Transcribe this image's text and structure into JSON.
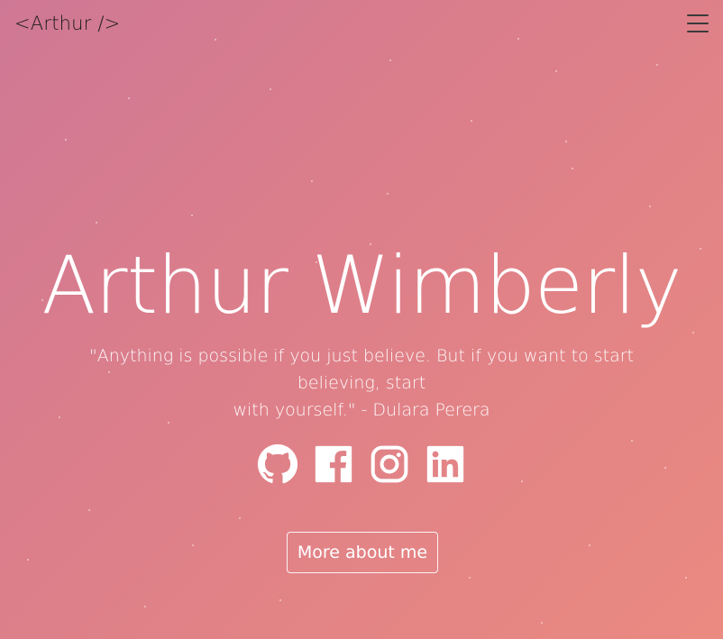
{
  "nav": {
    "brand": "<Arthur />",
    "menu_icon": "hamburger-menu-icon"
  },
  "hero": {
    "name": "Arthur Wimberly",
    "quote_line1": "\"Anything is possible if you just believe. But if you want to start believing, start",
    "quote_line2": "with yourself.\" - Dulara Perera"
  },
  "socials": [
    {
      "icon": "github-icon"
    },
    {
      "icon": "facebook-icon"
    },
    {
      "icon": "instagram-icon"
    },
    {
      "icon": "linkedin-icon"
    }
  ],
  "cta": {
    "label": "More about me"
  },
  "colors": {
    "gradient_start": "#cf7895",
    "gradient_end": "#eb8a80",
    "text": "#ffffff",
    "brand_text": "#1a1a1a"
  }
}
